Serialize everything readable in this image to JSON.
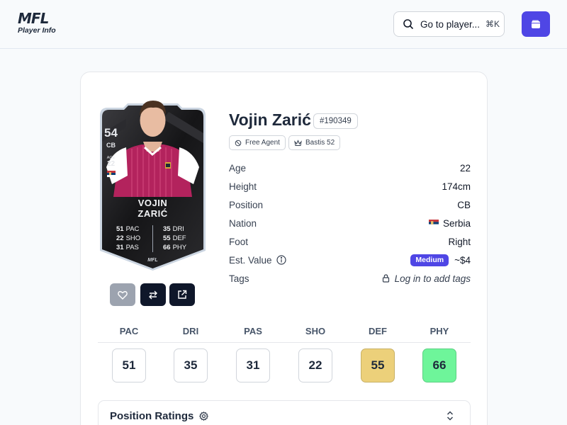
{
  "header": {
    "logo_text": "MFL",
    "logo_sub": "Player Info",
    "search_label": "Go to player...",
    "search_shortcut": "⌘K",
    "search_icon": "search-icon",
    "wallet_icon": "wallet-icon",
    "accent_color": "#4f46e5"
  },
  "card": {
    "rating": "54",
    "position": "CB",
    "age_label": "AGE",
    "age": "22",
    "first_name": "VOJIN",
    "last_name": "ZARIĆ",
    "stats_left": [
      {
        "value": "51",
        "label": "PAC"
      },
      {
        "value": "22",
        "label": "SHO"
      },
      {
        "value": "31",
        "label": "PAS"
      }
    ],
    "stats_right": [
      {
        "value": "35",
        "label": "DRI"
      },
      {
        "value": "55",
        "label": "DEF"
      },
      {
        "value": "66",
        "label": "PHY"
      }
    ],
    "brand": "MFL",
    "actions": [
      "heart-icon",
      "swap-icon",
      "external-link-icon"
    ]
  },
  "player": {
    "name": "Vojin Zarić",
    "id": "#190349",
    "status": "Free Agent",
    "club": "Bastis 52"
  },
  "info": {
    "rows": [
      {
        "label": "Age",
        "value": "22"
      },
      {
        "label": "Height",
        "value": "174cm"
      },
      {
        "label": "Position",
        "value": "CB"
      },
      {
        "label": "Nation",
        "value": "Serbia"
      },
      {
        "label": "Foot",
        "value": "Right"
      }
    ],
    "value_label": "Est. Value",
    "value_badge": "Medium",
    "value_amount": "~$4",
    "tags_label": "Tags",
    "tags_link": "Log in to add tags"
  },
  "stats": [
    {
      "label": "PAC",
      "value": "51",
      "color": "#ffffff"
    },
    {
      "label": "DRI",
      "value": "35",
      "color": "#ffffff"
    },
    {
      "label": "PAS",
      "value": "31",
      "color": "#ffffff"
    },
    {
      "label": "SHO",
      "value": "22",
      "color": "#ffffff"
    },
    {
      "label": "DEF",
      "value": "55",
      "color": "#ecd07a"
    },
    {
      "label": "PHY",
      "value": "66",
      "color": "#6ef59a"
    }
  ],
  "position_ratings": {
    "title": "Position Ratings"
  }
}
